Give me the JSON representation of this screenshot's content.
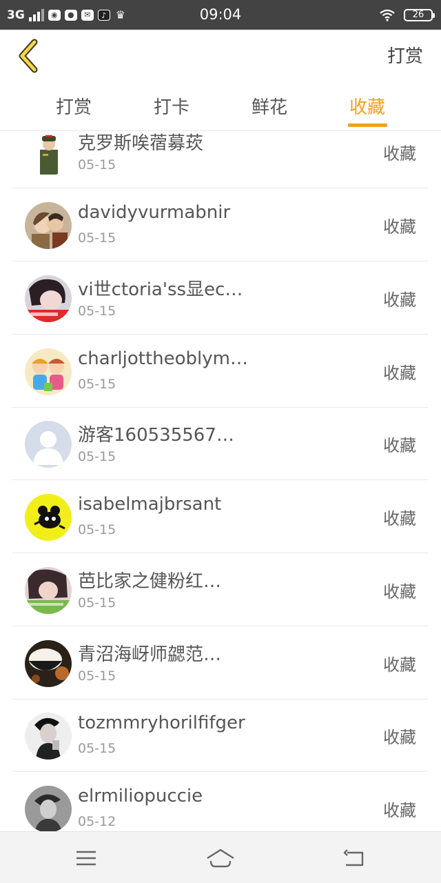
{
  "status_bar": {
    "network": "3G",
    "time": "09:04",
    "battery": "26",
    "app_icons": [
      "wechat-icon",
      "messenger-icon",
      "mail-icon",
      "tiktok-icon",
      "crown-icon"
    ]
  },
  "header": {
    "action_label": "打赏",
    "accent_color": "#f0a020"
  },
  "tabs": [
    {
      "label": "打赏"
    },
    {
      "label": "打卡"
    },
    {
      "label": "鲜花"
    },
    {
      "label": "收藏",
      "active": true
    }
  ],
  "list": [
    {
      "name": "克罗斯唉蓿募莰",
      "date": "05-15",
      "action": "收藏",
      "avatar": "soldier-avatar"
    },
    {
      "name": "davidyvurmabnir",
      "date": "05-15",
      "action": "收藏",
      "avatar": "couple-avatar"
    },
    {
      "name": "vi世ctoria'ss显ec…",
      "date": "05-15",
      "action": "收藏",
      "avatar": "girl-photo-avatar"
    },
    {
      "name": "charljottheoblym…",
      "date": "05-15",
      "action": "收藏",
      "avatar": "cartoon-kids-avatar"
    },
    {
      "name": "游客160535567…",
      "date": "05-15",
      "action": "收藏",
      "avatar": "default-user-avatar"
    },
    {
      "name": "isabelmajbrsant",
      "date": "05-15",
      "action": "收藏",
      "avatar": "cartoon-bear-avatar"
    },
    {
      "name": "芭比家之健粉红…",
      "date": "05-15",
      "action": "收藏",
      "avatar": "girl-pink-avatar"
    },
    {
      "name": "青沼海岈师勰范…",
      "date": "05-15",
      "action": "收藏",
      "avatar": "rice-bowl-avatar"
    },
    {
      "name": "tozmmryhorilfifger",
      "date": "05-15",
      "action": "收藏",
      "avatar": "man-bw-avatar"
    },
    {
      "name": "elrmiliopuccie",
      "date": "05-12",
      "action": "收藏",
      "avatar": "man-grey-avatar"
    }
  ],
  "navbar": {
    "icons": [
      "menu-icon",
      "home-icon",
      "back-icon"
    ]
  }
}
